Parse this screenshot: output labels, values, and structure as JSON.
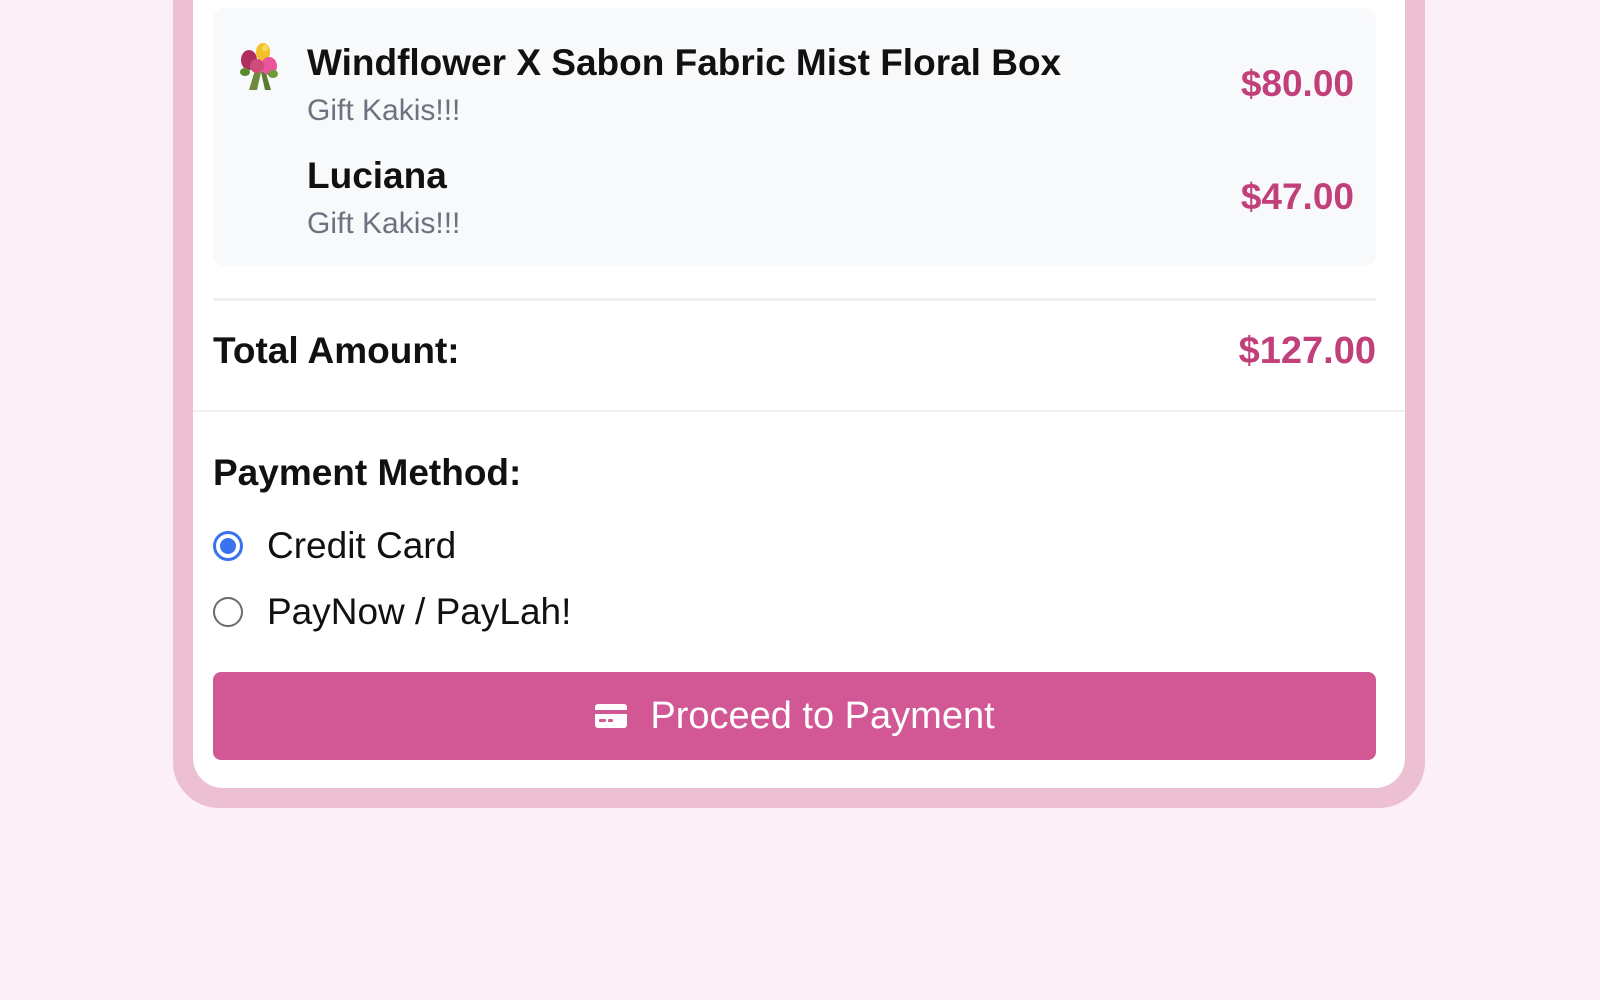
{
  "order": {
    "items": [
      {
        "name": "Windflower X Sabon Fabric Mist Floral Box",
        "note": "Gift Kakis!!!",
        "price": "$80.00",
        "icon": "bouquet-icon"
      },
      {
        "name": "Luciana",
        "note": "Gift Kakis!!!",
        "price": "$47.00"
      }
    ],
    "total_label": "Total Amount:",
    "total_value": "$127.00"
  },
  "payment": {
    "title": "Payment Method:",
    "options": [
      {
        "label": "Credit Card",
        "selected": true
      },
      {
        "label": "PayNow / PayLah!",
        "selected": false
      }
    ],
    "button_label": "Proceed to Payment",
    "button_icon": "credit-card-icon"
  },
  "colors": {
    "page_background": "#fcf0f6",
    "frame_border": "#ecbfd2",
    "accent_price": "#c2407a",
    "button_background": "#d25795",
    "radio_selected": "#3b72f0"
  }
}
